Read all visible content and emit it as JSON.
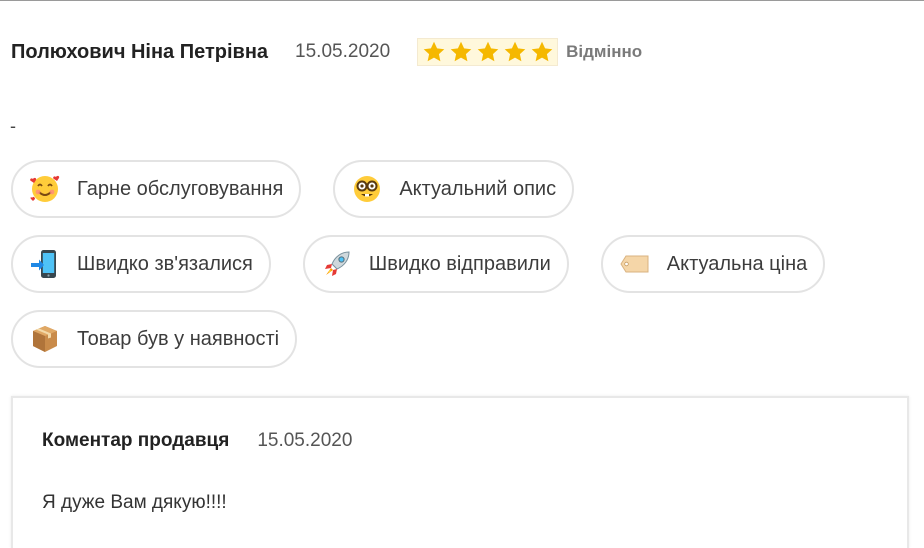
{
  "review": {
    "author": "Полюхович Ніна Петрівна",
    "date": "15.05.2020",
    "rating": 5,
    "rating_max": 5,
    "rating_label": "Відмінно",
    "text": "-",
    "star_color": "#f5b800"
  },
  "tags": [
    {
      "label": "Гарне обслуговування",
      "icon": "smiling-face-with-hearts-icon"
    },
    {
      "label": "Актуальний опис",
      "icon": "nerd-face-icon"
    },
    {
      "label": "Швидко зв'язалися",
      "icon": "mobile-phone-arrow-icon"
    },
    {
      "label": "Швидко відправили",
      "icon": "rocket-icon"
    },
    {
      "label": "Актуальна ціна",
      "icon": "price-tag-icon"
    },
    {
      "label": "Товар був у наявності",
      "icon": "package-icon"
    }
  ],
  "seller_reply": {
    "title": "Коментар продавця",
    "date": "15.05.2020",
    "text": "Я дуже Вам дякую!!!!"
  }
}
